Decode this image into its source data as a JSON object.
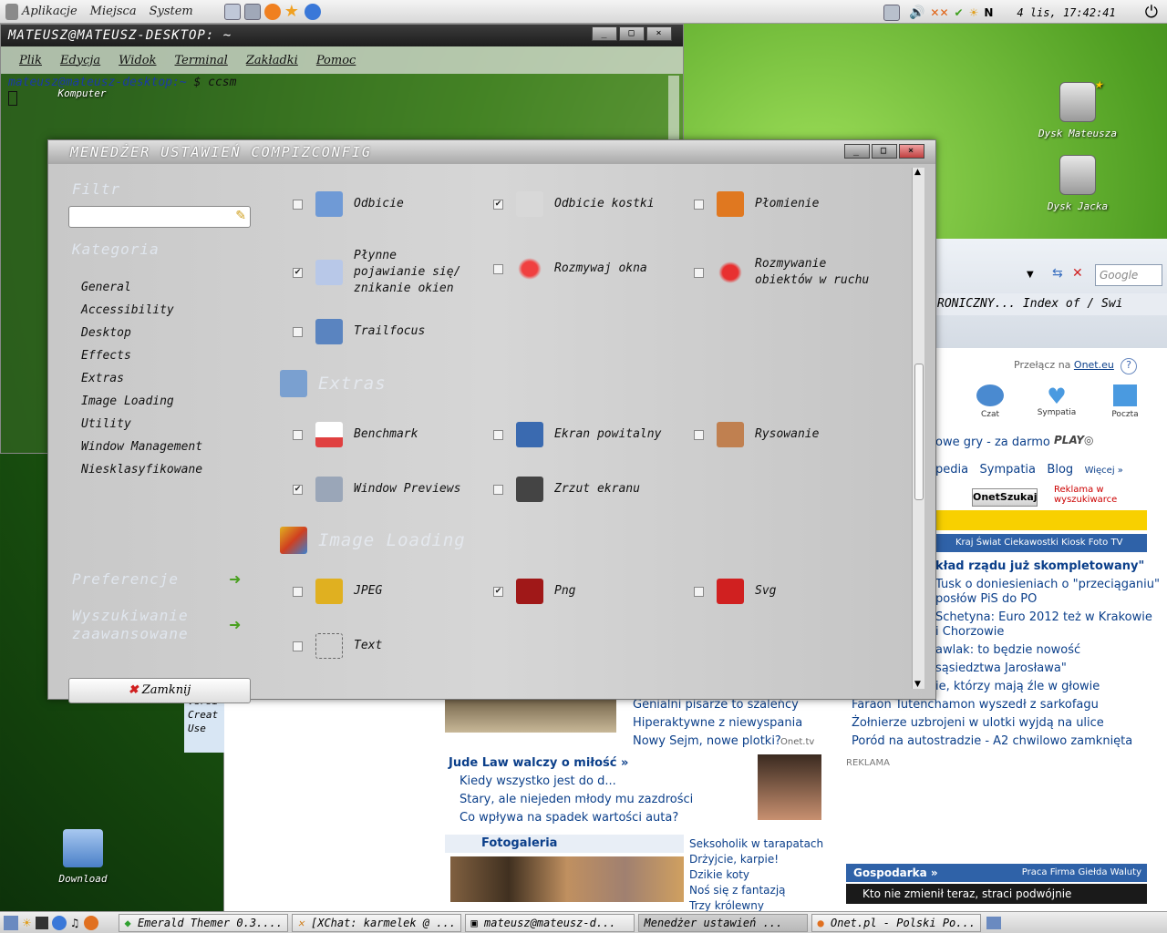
{
  "top_panel": {
    "menus": [
      "Aplikacje",
      "Miejsca",
      "System"
    ],
    "indicator": "N",
    "clock": "4 lis, 17:42:41"
  },
  "desktop": {
    "icons": [
      "Komputer",
      "Dysk Mateusza",
      "Dysk Jacka",
      "Download"
    ]
  },
  "terminal": {
    "title": "MATEUSZ@MATEUSZ-DESKTOP: ~",
    "menu": [
      "Plik",
      "Edycja",
      "Widok",
      "Terminal",
      "Zakładki",
      "Pomoc"
    ],
    "prompt_user": "mateusz@mateusz-desktop:",
    "prompt_path": "~",
    "command": "$ ccsm",
    "buttons": [
      "_",
      "□",
      "×"
    ]
  },
  "ccsm": {
    "title": "MENEDŻER USTAWIEŃ COMPIZCONFIG",
    "filter_label": "Filtr",
    "category_label": "Kategoria",
    "categories": [
      "General",
      "Accessibility",
      "Desktop",
      "Effects",
      "Extras",
      "Image Loading",
      "Utility",
      "Window Management",
      "Niesklasyfikowane"
    ],
    "preferences_label": "Preferencje",
    "advanced_search_label": "Wyszukiwanie zaawansowane",
    "close_label": "Zamknij",
    "plugins": [
      {
        "label": "Odbicie",
        "checked": false,
        "color": "#6f9ad6"
      },
      {
        "label": "Odbicie kostki",
        "checked": true,
        "color": "#d8d8d8"
      },
      {
        "label": "Płomienie",
        "checked": false,
        "color": "#e07820"
      },
      {
        "label": "Płynne pojawianie się/ znikanie okien",
        "checked": true,
        "color": "#b8c8e8"
      },
      {
        "label": "Rozmywaj okna",
        "checked": false,
        "color": "#e02020"
      },
      {
        "label": "Rozmywanie obiektów w ruchu",
        "checked": false,
        "color": "#e83030"
      },
      {
        "label": "Trailfocus",
        "checked": false,
        "color": "#5a84c0"
      }
    ],
    "extras_section": "Extras",
    "extras_plugins": [
      {
        "label": "Benchmark",
        "checked": false,
        "color": "#e04040"
      },
      {
        "label": "Ekran powitalny",
        "checked": false,
        "color": "#3a6ab0"
      },
      {
        "label": "Rysowanie",
        "checked": false,
        "color": "#c08050"
      },
      {
        "label": "Window Previews",
        "checked": true,
        "color": "#9aa6b8"
      },
      {
        "label": "Zrzut ekranu",
        "checked": false,
        "color": "#444444"
      }
    ],
    "image_section": "Image Loading",
    "image_plugins": [
      {
        "label": "JPEG",
        "checked": false,
        "color": "#e0b020"
      },
      {
        "label": "Png",
        "checked": true,
        "color": "#a01818"
      },
      {
        "label": "Svg",
        "checked": false,
        "color": "#d02020"
      },
      {
        "label": "Text",
        "checked": false,
        "color": "#666666"
      }
    ],
    "checkmark": "✔"
  },
  "browser": {
    "search_placeholder": "Google",
    "links": "RONICZNY...  Index of /   Swi",
    "switch_text": "Przełącz na",
    "switch_link": "Onet.eu",
    "services": [
      "Czat",
      "Sympatia",
      "Poczta"
    ],
    "games_line": "owe gry - za darmo",
    "tabs_line": [
      "pedia",
      "Sympatia",
      "Blog",
      "Więcej »"
    ],
    "search_button": "OnetSzukaj",
    "ad_text": "Reklama w wyszukiwarce",
    "news_nav": "Kraj  Świat  Ciekawostki  Kiosk  Foto  TV",
    "headlines_right": [
      "kład rządu już skompletowany\"",
      "Tusk o doniesieniach o \"przeciąganiu\"",
      "posłów PiS do PO",
      "Schetyna: Euro 2012 też w Krakowie",
      "i Chorzowie",
      "awlak: to będzie nowość",
      "sąsiedztwa Jarosława\"",
      "ie, którzy mają źle w głowie",
      "Faraon Tutenchamon wyszedł z sarkofagu",
      "Żołnierze uzbrojeni w ulotki wyjdą na ulice",
      "Poród na autostradzie - A2 chwilowo zamknięta"
    ],
    "headlines_mid": [
      "Genialni pisarze to szaleńcy",
      "Hiperaktywne z niewyspania",
      "Nowy Sejm, nowe plotki?"
    ],
    "onet_tv": "Onet.tv",
    "reklama": "REKLAMA",
    "jude_title": "Jude Law walczy o miłość »",
    "jude_items": [
      "Kiedy wszystko jest do d...",
      "Stary, ale niejeden młody mu zazdrości",
      "Co wpływa na spadek wartości auta?"
    ],
    "foto_title": "Fotogaleria",
    "foto_items": [
      "Seksoholik w tarapatach",
      "Drżyjcie, karpie!",
      "Dzikie koty",
      "Noś się z fantazją",
      "Trzy królewny"
    ],
    "gospodarka": "Gospodarka »",
    "gospodarka_links": "Praca  Firma  Giełda  Waluty",
    "gospodarka_banner": "Kto nie zmienił teraz, straci podwójnie",
    "side_text": [
      "Versi",
      "Creat",
      "Use"
    ]
  },
  "taskbar": [
    "Emerald Themer 0.3....",
    "[XChat: karmelek @ ...",
    "mateusz@mateusz-d...",
    "Menedżer ustawień ...",
    "Onet.pl - Polski Po..."
  ]
}
